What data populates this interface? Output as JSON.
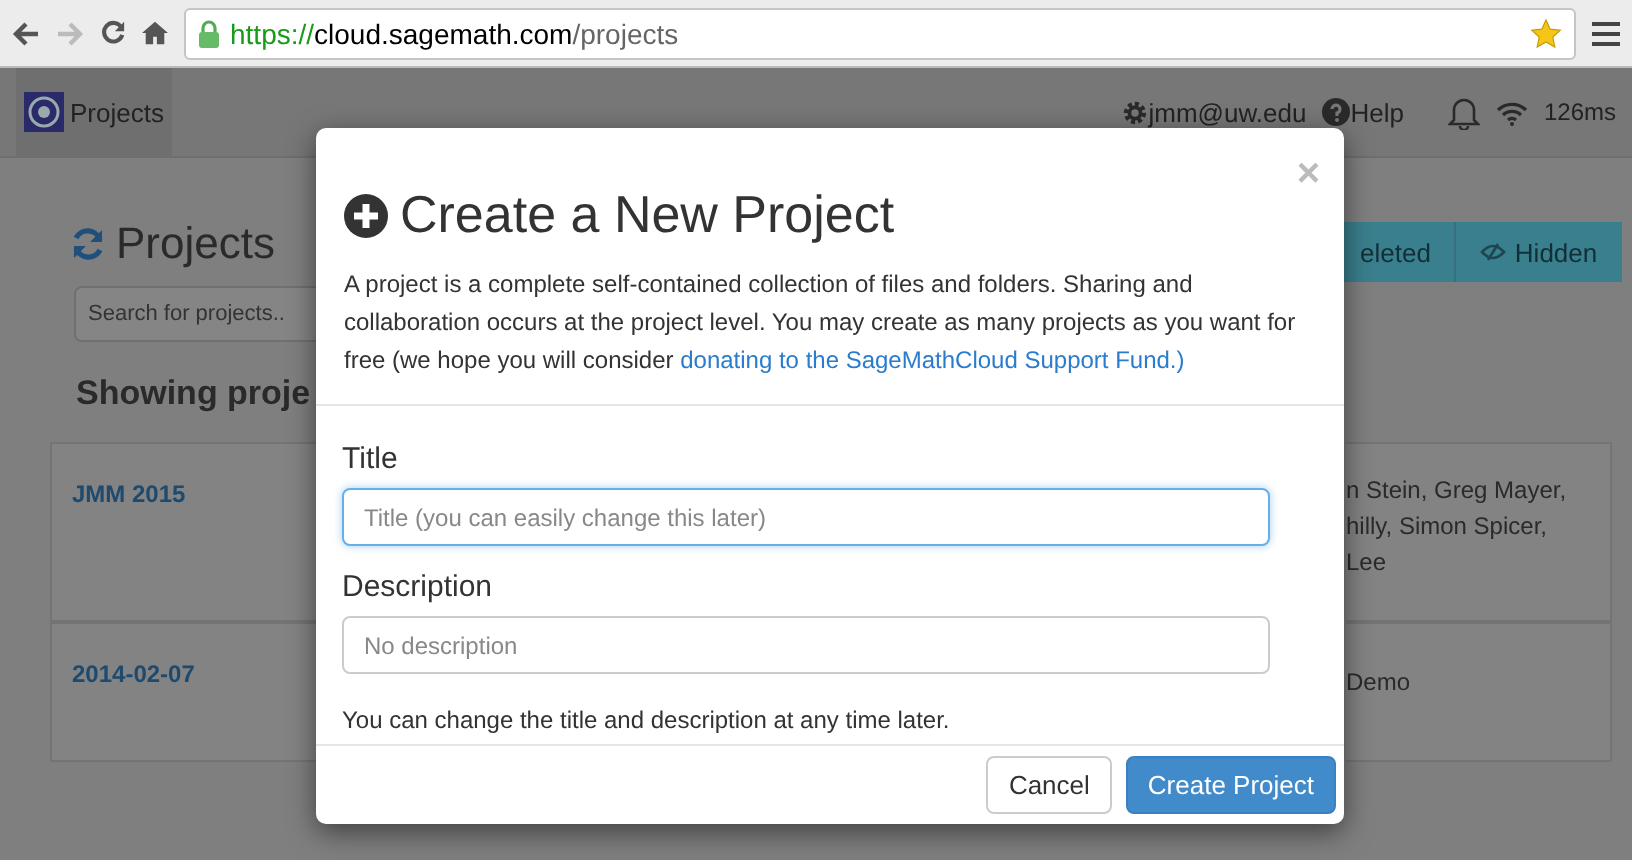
{
  "browser": {
    "url_secure": "https://",
    "url_host": "cloud.sagemath.com",
    "url_path": "/projects"
  },
  "navbar": {
    "brand": "Projects",
    "account": "jmm@uw.edu",
    "help": "Help",
    "ping": "126ms"
  },
  "page": {
    "heading": "Projects",
    "search": {
      "placeholder": "Search for projects.."
    },
    "showing": "Showing proje",
    "filter_buttons": [
      {
        "label": "eleted",
        "kind": "text"
      },
      {
        "label": "Hidden",
        "kind": "eye"
      }
    ],
    "projects": [
      {
        "title": "JMM 2015",
        "details": [
          "n Stein, Greg Mayer,",
          "hilly, Simon Spicer,",
          "Lee"
        ]
      },
      {
        "title": "2014-02-07",
        "details": [
          "Demo"
        ]
      }
    ]
  },
  "modal": {
    "close": "×",
    "title": "Create a New Project",
    "intro": "A project is a complete self-contained collection of files and folders. Sharing and collaboration occurs at the project level. You may create as many projects as you want for free (we hope you will consider ",
    "intro_link": "donating to the SageMathCloud Support Fund.)",
    "fields": [
      {
        "label": "Title",
        "placeholder": "Title (you can easily change this later)",
        "focused": true
      },
      {
        "label": "Description",
        "placeholder": "No description",
        "focused": false
      }
    ],
    "help": "You can change the title and description at any time later.",
    "buttons": [
      {
        "label": "Cancel",
        "primary": false
      },
      {
        "label": "Create Project",
        "primary": true
      }
    ]
  }
}
